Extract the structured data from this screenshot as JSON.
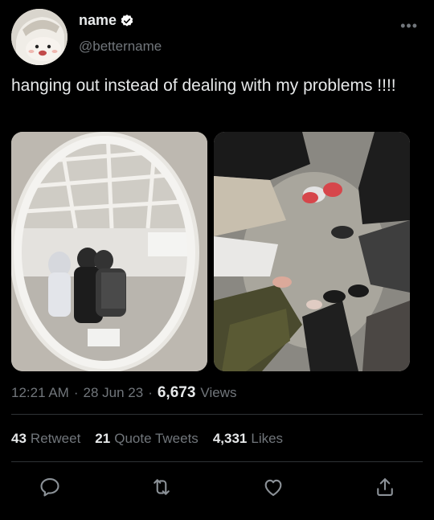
{
  "user": {
    "name": "name",
    "handle": "@bettername",
    "verified": true,
    "avatar_icon": "avatar-illustration"
  },
  "tweet": {
    "text": "hanging out instead of dealing with my problems !!!!"
  },
  "meta": {
    "time": "12:21 AM",
    "sep1": "·",
    "date": "28 Jun 23",
    "sep2": "·",
    "views_count": "6,673",
    "views_label": "Views"
  },
  "stats": {
    "retweets_count": "43",
    "retweets_label": "Retweet",
    "quotes_count": "21",
    "quotes_label": "Quote Tweets",
    "likes_count": "4,331",
    "likes_label": "Likes"
  },
  "actions": [
    {
      "name": "reply",
      "icon": "reply-icon"
    },
    {
      "name": "retweet",
      "icon": "retweet-icon"
    },
    {
      "name": "like",
      "icon": "heart-icon"
    },
    {
      "name": "share",
      "icon": "share-icon"
    }
  ],
  "colors": {
    "background": "#000000",
    "text": "#e7e9ea",
    "secondary": "#71767b",
    "divider": "#2f3336",
    "verified": "#ffffff"
  },
  "more_icon": "more-icon"
}
